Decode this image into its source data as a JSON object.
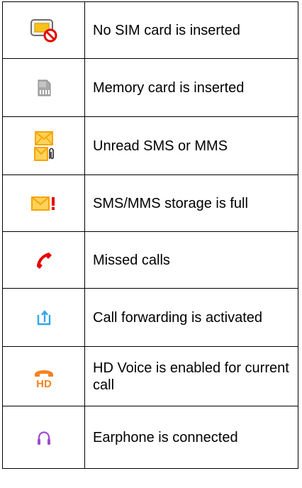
{
  "table": {
    "rows": [
      {
        "icon": "no-sim-card-icon",
        "label": "No SIM card is inserted"
      },
      {
        "icon": "memory-card-icon",
        "label": "Memory card is inserted"
      },
      {
        "icon": "unread-message-icon",
        "label": "Unread SMS or MMS"
      },
      {
        "icon": "message-storage-full-icon",
        "label": "SMS/MMS storage is full"
      },
      {
        "icon": "missed-call-icon",
        "label": "Missed calls"
      },
      {
        "icon": "call-forwarding-icon",
        "label": "Call forwarding is activated"
      },
      {
        "icon": "hd-voice-icon",
        "label": "HD Voice is enabled for current call",
        "badge": "HD"
      },
      {
        "icon": "earphone-icon",
        "label": "Earphone is connected"
      }
    ]
  },
  "colors": {
    "envelope": "#f7a400",
    "envelope_light": "#ffd25a",
    "alert_red": "#e60000",
    "call_forward_blue": "#33a6e8",
    "hd_orange": "#f58220",
    "earphone_purple": "#a04ad0",
    "memory_gray": "#9a9a9a"
  }
}
